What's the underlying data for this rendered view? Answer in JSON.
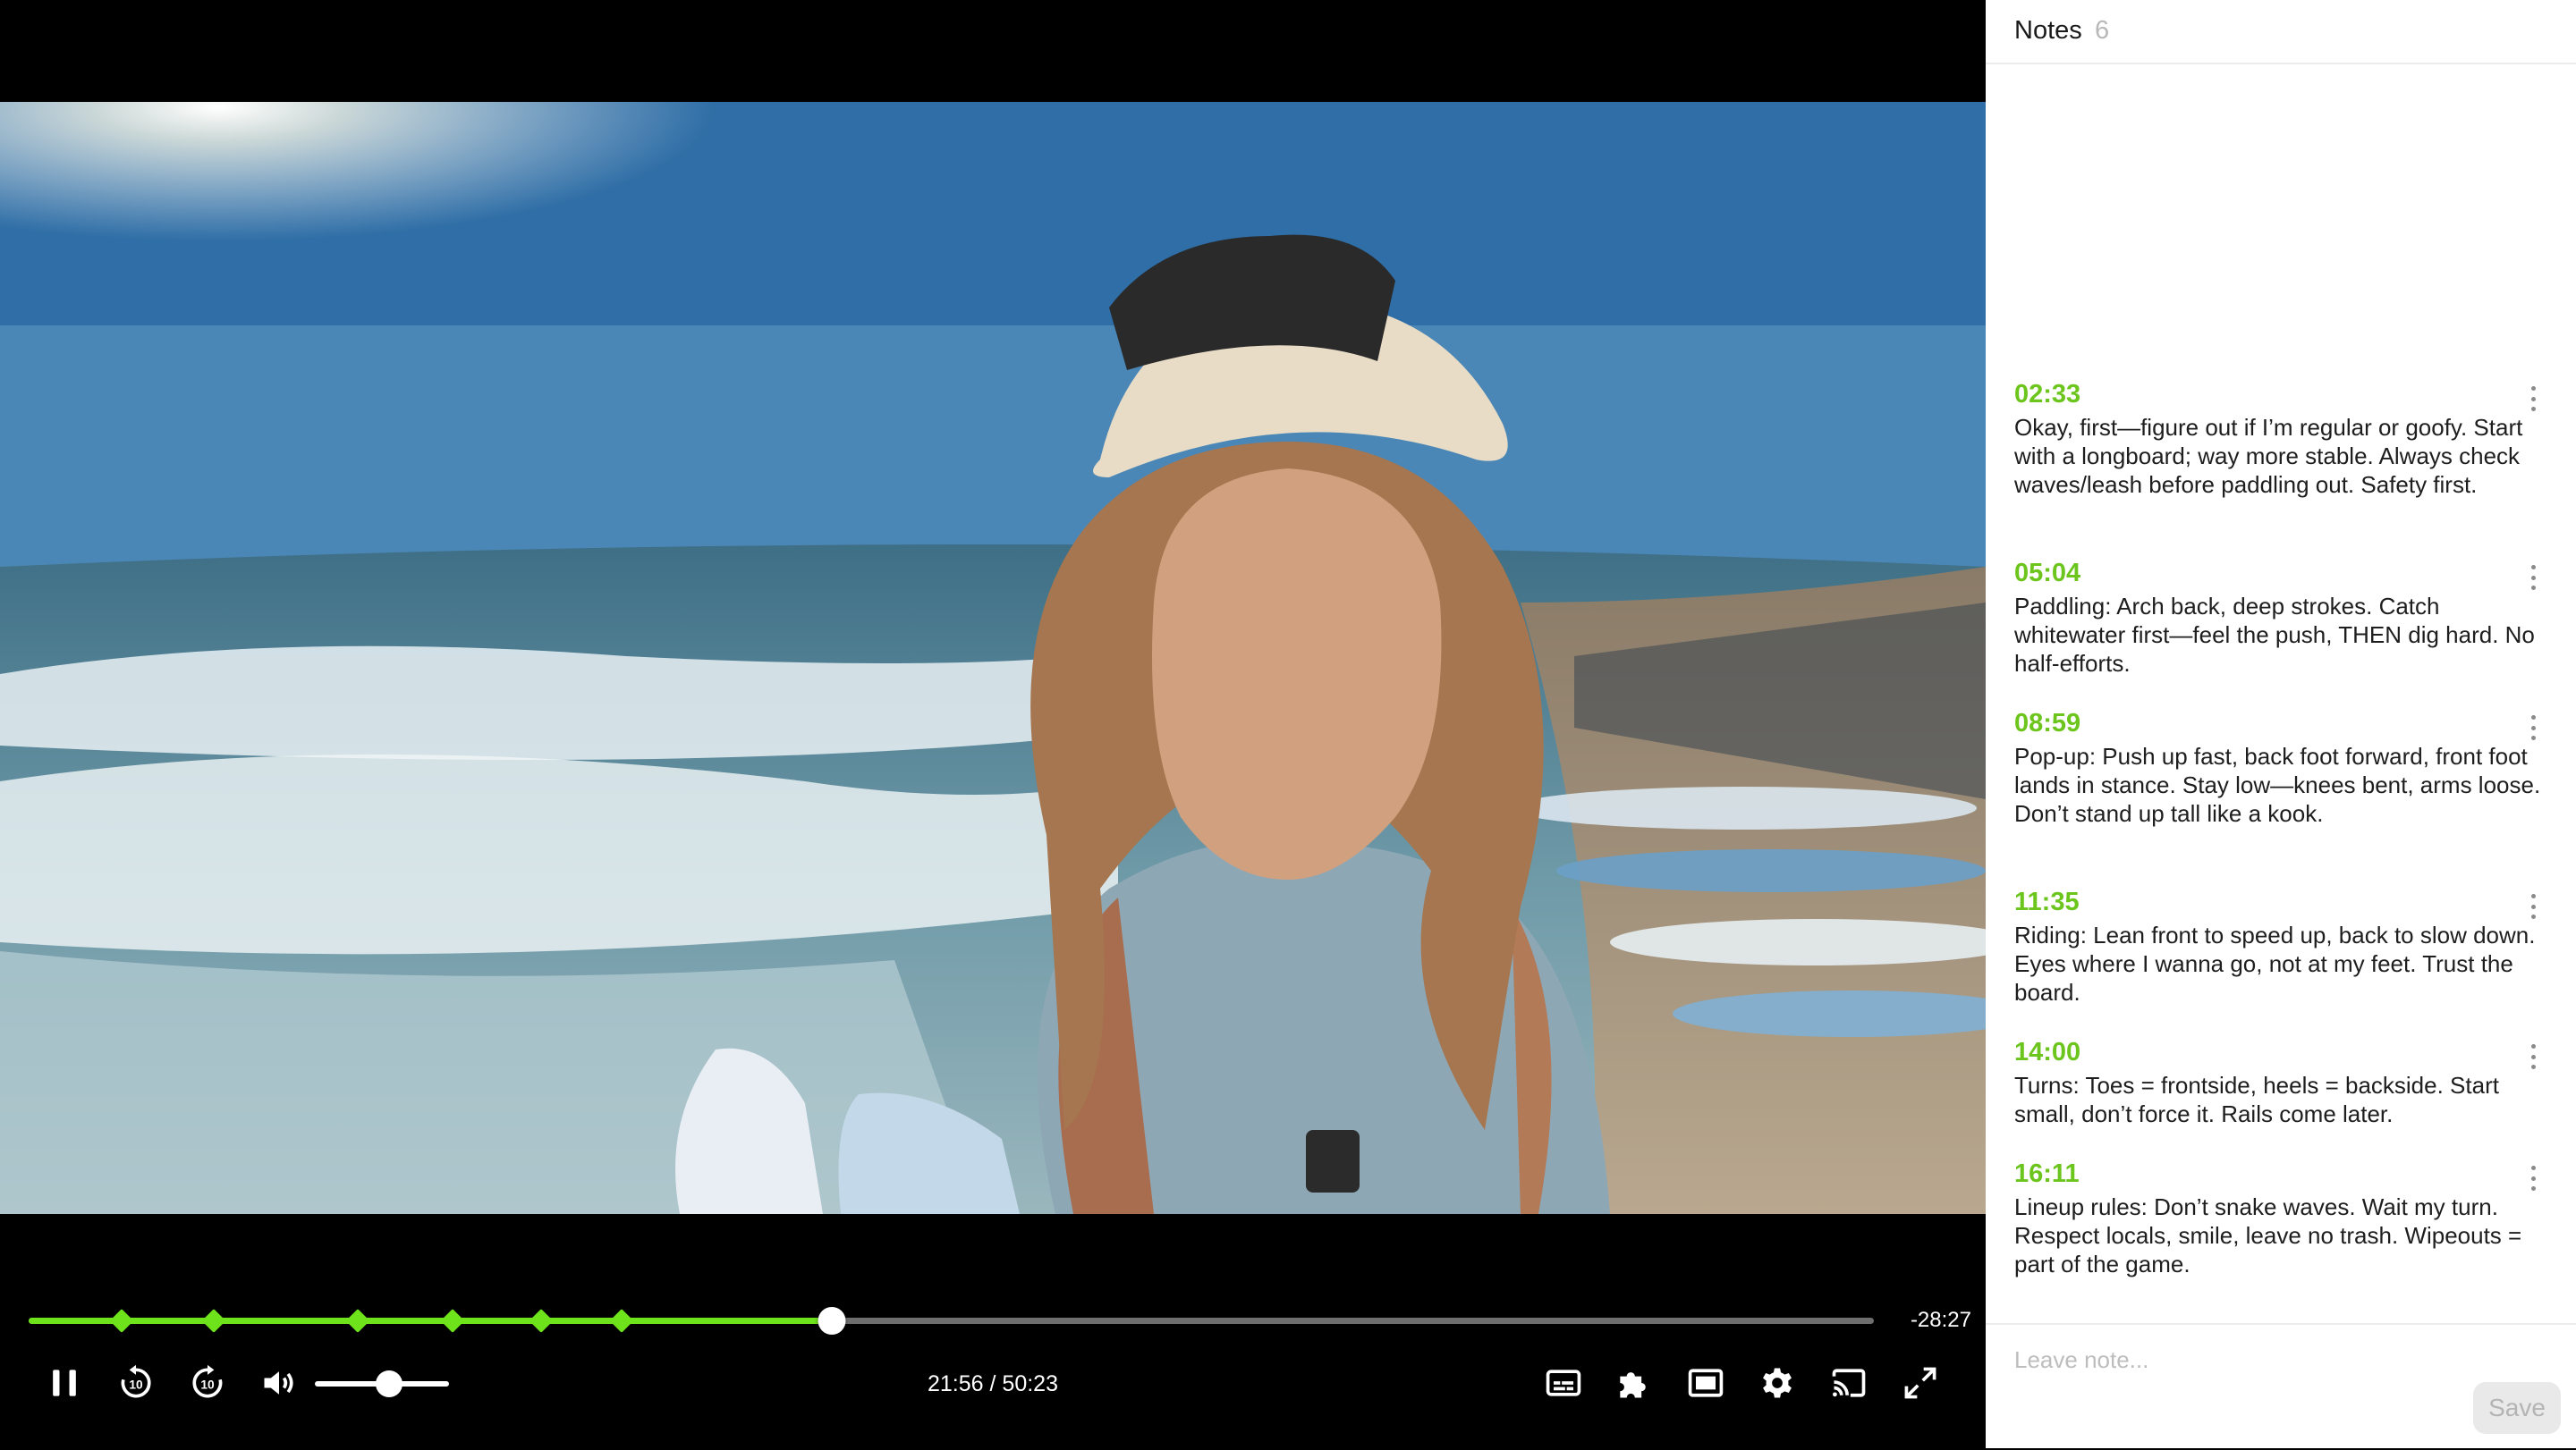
{
  "player": {
    "remaining": "-28:27",
    "current_time": "21:56",
    "separator": "/",
    "duration": "50:23",
    "progress_fraction": 0.4334,
    "note_markers": [
      "02:33",
      "05:04",
      "08:59",
      "11:35",
      "14:00",
      "16:11"
    ],
    "marker_seconds": [
      153,
      304,
      539,
      695,
      840,
      971
    ],
    "duration_seconds": 3023,
    "current_seconds": 1316,
    "volume_fraction": 0.55,
    "accent_color": "#6ee31b",
    "controls": {
      "play_pause": "pause-icon",
      "rewind": "rewind-10-icon",
      "forward": "forward-10-icon",
      "volume": "volume-icon",
      "captions": "captions-icon",
      "chapters": "puzzle-icon",
      "pip": "picture-in-picture-icon",
      "settings": "gear-icon",
      "cast": "cast-icon",
      "fullscreen": "fullscreen-icon"
    }
  },
  "notes": {
    "title": "Notes",
    "count": "6",
    "items": [
      {
        "time": "02:33",
        "text": "Okay, first—figure out if I’m regular or goofy. Start with a longboard; way more stable. Always check waves/leash before paddling out. Safety first."
      },
      {
        "time": "05:04",
        "text": "Paddling: Arch back, deep strokes. Catch whitewater first—feel the push, THEN dig hard. No half-efforts."
      },
      {
        "time": "08:59",
        "text": "Pop-up: Push up fast, back foot forward, front foot lands in stance. Stay low—knees bent, arms loose. Don’t stand up tall like a kook."
      },
      {
        "time": "11:35",
        "text": "Riding: Lean front to speed up, back to slow down. Eyes where I wanna go, not at my feet. Trust the board."
      },
      {
        "time": "14:00",
        "text": "Turns: Toes = frontside, heels = backside. Start small, don’t force it. Rails come later."
      },
      {
        "time": "16:11",
        "text": "Lineup rules: Don’t snake waves. Wait my turn. Respect locals, smile, leave no trash. Wipeouts = part of the game."
      }
    ],
    "compose_placeholder": "Leave note...",
    "save_label": "Save",
    "time_color": "#6cc51c"
  }
}
